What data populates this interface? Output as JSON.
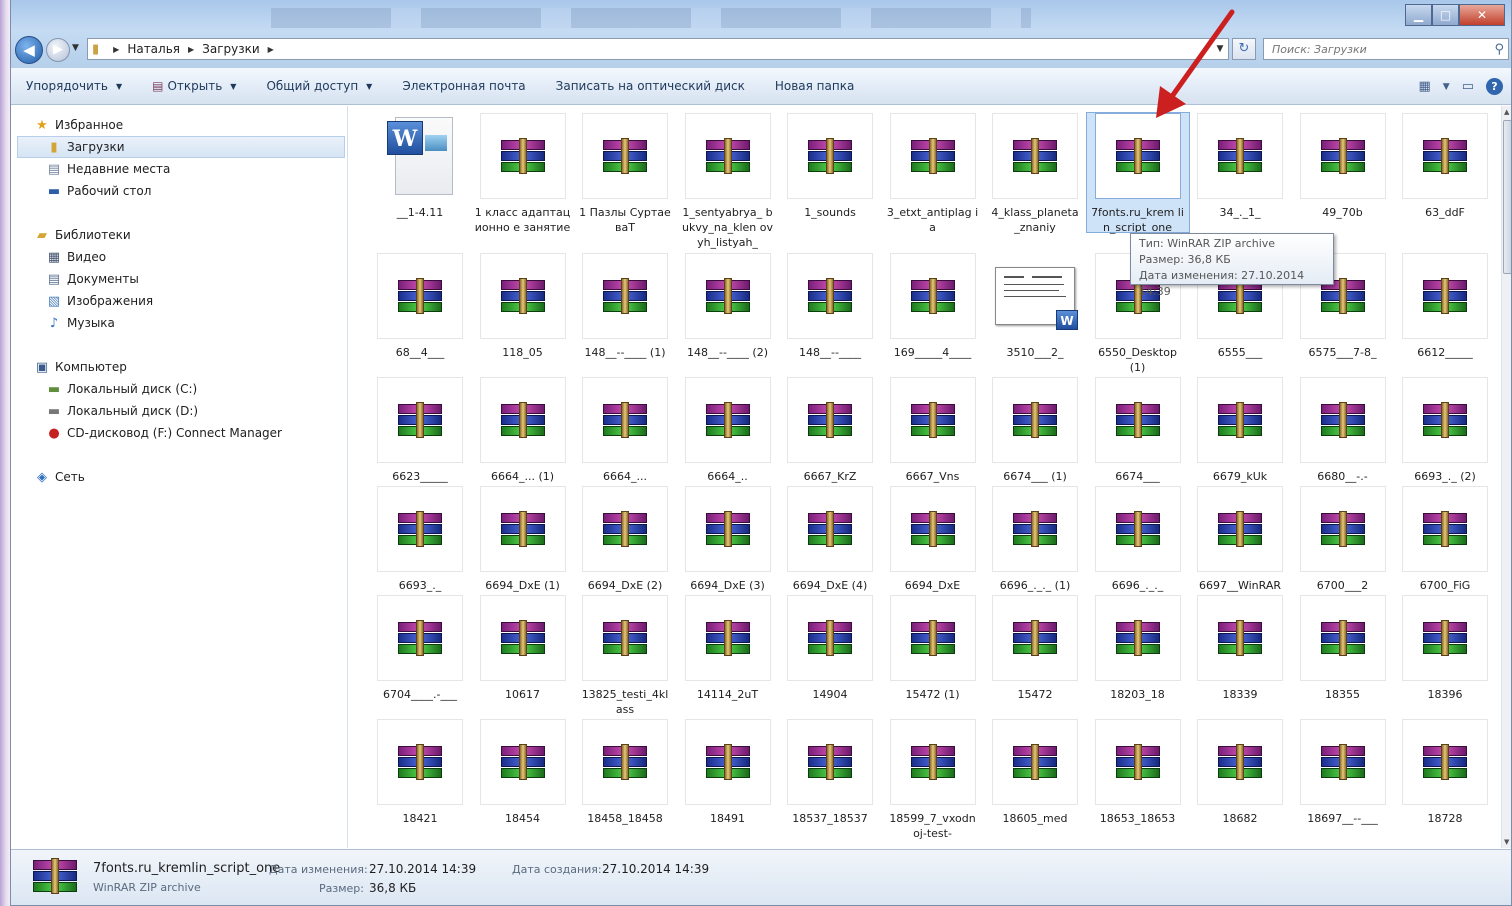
{
  "address_bar": {
    "crumbs": [
      "Наталья",
      "Загрузки"
    ]
  },
  "search": {
    "placeholder": "Поиск: Загрузки"
  },
  "toolbar": {
    "organize": "Упорядочить",
    "open": "Открыть",
    "share": "Общий доступ",
    "email": "Электронная почта",
    "burn": "Записать на оптический диск",
    "new_folder": "Новая папка"
  },
  "nav": {
    "favorites": "Избранное",
    "favorites_items": [
      "Загрузки",
      "Недавние места",
      "Рабочий стол"
    ],
    "libraries": "Библиотеки",
    "libraries_items": [
      "Видео",
      "Документы",
      "Изображения",
      "Музыка"
    ],
    "computer": "Компьютер",
    "computer_items": [
      "Локальный диск (C:)",
      "Локальный диск (D:)",
      "CD-дисковод (F:) Connect Manager"
    ],
    "network": "Сеть"
  },
  "files": [
    {
      "name": "__1-4.11",
      "type": "word"
    },
    {
      "name": "1 класс адаптационно е занятие",
      "type": "rar"
    },
    {
      "name": "1 Пазлы СуртаеваТ",
      "type": "rar"
    },
    {
      "name": "1_sentyabrya_ bukvy_na_klen ovyh_listyah_",
      "type": "rar"
    },
    {
      "name": "1_sounds",
      "type": "rar"
    },
    {
      "name": "3_etxt_antiplag ia",
      "type": "rar"
    },
    {
      "name": "4_klass_planeta _znaniy",
      "type": "rar"
    },
    {
      "name": "7fonts.ru_krem lin_script_one",
      "type": "rar",
      "selected": true
    },
    {
      "name": "34_._1_",
      "type": "rar"
    },
    {
      "name": "49_70b",
      "type": "rar"
    },
    {
      "name": "63_ddF",
      "type": "rar"
    },
    {
      "name": "68__4___",
      "type": "rar"
    },
    {
      "name": "118_05",
      "type": "rar"
    },
    {
      "name": "148__--____ (1)",
      "type": "rar"
    },
    {
      "name": "148__--____ (2)",
      "type": "rar"
    },
    {
      "name": "148__--____",
      "type": "rar"
    },
    {
      "name": "169_____4____",
      "type": "rar"
    },
    {
      "name": "3510___2_",
      "type": "doc"
    },
    {
      "name": "6550_Desktop (1)",
      "type": "rar"
    },
    {
      "name": "6555___",
      "type": "rar"
    },
    {
      "name": "6575___7-8_",
      "type": "rar"
    },
    {
      "name": "6612_____",
      "type": "rar"
    },
    {
      "name": "6623_____",
      "type": "rar"
    },
    {
      "name": "6664_... (1)",
      "type": "rar"
    },
    {
      "name": "6664_...",
      "type": "rar"
    },
    {
      "name": "6664_..",
      "type": "rar"
    },
    {
      "name": "6667_KrZ",
      "type": "rar"
    },
    {
      "name": "6667_Vns",
      "type": "rar"
    },
    {
      "name": "6674___ (1)",
      "type": "rar"
    },
    {
      "name": "6674___",
      "type": "rar"
    },
    {
      "name": "6679_kUk",
      "type": "rar"
    },
    {
      "name": "6680__-.-",
      "type": "rar"
    },
    {
      "name": "6693_._ (2)",
      "type": "rar"
    },
    {
      "name": "6693_._",
      "type": "rar"
    },
    {
      "name": "6694_DxE (1)",
      "type": "rar"
    },
    {
      "name": "6694_DxE (2)",
      "type": "rar"
    },
    {
      "name": "6694_DxE (3)",
      "type": "rar"
    },
    {
      "name": "6694_DxE (4)",
      "type": "rar"
    },
    {
      "name": "6694_DxE",
      "type": "rar"
    },
    {
      "name": "6696_._._ (1)",
      "type": "rar"
    },
    {
      "name": "6696_._._",
      "type": "rar"
    },
    {
      "name": "6697__WinRAR",
      "type": "rar"
    },
    {
      "name": "6700___2",
      "type": "rar"
    },
    {
      "name": "6700_FiG",
      "type": "rar"
    },
    {
      "name": "6704____.-___",
      "type": "rar"
    },
    {
      "name": "10617",
      "type": "rar"
    },
    {
      "name": "13825_testi_4kl ass",
      "type": "rar"
    },
    {
      "name": "14114_2uT",
      "type": "rar"
    },
    {
      "name": "14904",
      "type": "rar"
    },
    {
      "name": "15472 (1)",
      "type": "rar"
    },
    {
      "name": "15472",
      "type": "rar"
    },
    {
      "name": "18203_18",
      "type": "rar"
    },
    {
      "name": "18339",
      "type": "rar"
    },
    {
      "name": "18355",
      "type": "rar"
    },
    {
      "name": "18396",
      "type": "rar"
    },
    {
      "name": "18421",
      "type": "rar"
    },
    {
      "name": "18454",
      "type": "rar"
    },
    {
      "name": "18458_18458",
      "type": "rar"
    },
    {
      "name": "18491",
      "type": "rar"
    },
    {
      "name": "18537_18537",
      "type": "rar"
    },
    {
      "name": "18599_7_vxodn oj-test-",
      "type": "rar"
    },
    {
      "name": "18605_med",
      "type": "rar"
    },
    {
      "name": "18653_18653",
      "type": "rar"
    },
    {
      "name": "18682",
      "type": "rar"
    },
    {
      "name": "18697__--___",
      "type": "rar"
    },
    {
      "name": "18728",
      "type": "rar"
    }
  ],
  "tooltip": {
    "type": "Тип: WinRAR ZIP archive",
    "size": "Размер: 36,8 КБ",
    "modified": "Дата изменения: 27.10.2014 14:39"
  },
  "details": {
    "name": "7fonts.ru_kremlin_script_one",
    "type": "WinRAR ZIP archive",
    "modified_label": "Дата изменения:",
    "modified_value": "27.10.2014 14:39",
    "size_label": "Размер:",
    "size_value": "36,8 КБ",
    "created_label": "Дата создания:",
    "created_value": "27.10.2014 14:39"
  },
  "colors": {
    "accent_arrow": "#cc1f1f",
    "selection": "#cfe3f8"
  },
  "icons": {
    "folder": "folder-icon",
    "archive": "winrar-archive-icon",
    "word": "word-document-icon"
  }
}
